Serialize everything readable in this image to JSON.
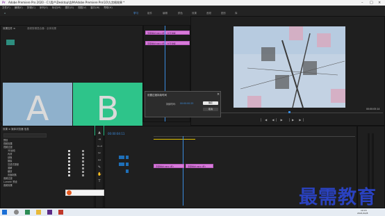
{
  "window": {
    "title": "Adobe Premiere Pro 2020 - C:\\用户\\Desktop\\含种\\Adobe Premiere Pro\\10\\九宫格效果 *"
  },
  "menu": [
    "文件(F)",
    "编辑(E)",
    "剪辑(C)",
    "序列(S)",
    "标记(M)",
    "图形(G)",
    "视图(V)",
    "窗口(W)",
    "帮助(H)"
  ],
  "workspaces": [
    "学习",
    "组件",
    "编辑",
    "颜色",
    "效果",
    "音频",
    "图形",
    "库"
  ],
  "source_panel": {
    "tab": "效果控件 ≡",
    "sub_tab": "音频剪辑混合器：全体效果"
  },
  "program_left": {
    "label_a": "A",
    "label_b": "B",
    "color_a": "#8fb1cc",
    "color_b": "#2ec48a"
  },
  "top_timeline": {
    "clip_top": "宝藏素材.MP4 [视] - 交叉溶解",
    "clip_bottom": "宝藏素材.MP4 [视] - 交叉溶解"
  },
  "program_monitor": {
    "timecode_left": "00:00:00:00",
    "timecode_right": "00:00:05:14"
  },
  "dialog": {
    "title": "设置过渡持续时间",
    "label": "持续时间：",
    "value": "00:00:00:25",
    "ok": "确定",
    "cancel": "取消"
  },
  "effects_panel": {
    "header": "效果 ≡ 媒体浏览器 信息",
    "items": [
      "预设",
      "视频效果",
      "视频过渡",
      "3D运动",
      "内滑",
      "划像",
      "擦除",
      "沉浸式视频",
      "溶解",
      "缩放",
      "页面剥落",
      "音频过渡",
      "Lumetri 预设",
      "音频效果"
    ]
  },
  "timeline": {
    "timecode": "00:00:04:11",
    "clip_a": "宝藏素材.MP4 [视]",
    "clip_b": "宝藏素材.MP4 [视]"
  },
  "taskbar": {
    "time": "10:15",
    "date": "2021/10/8"
  },
  "watermark": {
    "text": "最需教育"
  }
}
